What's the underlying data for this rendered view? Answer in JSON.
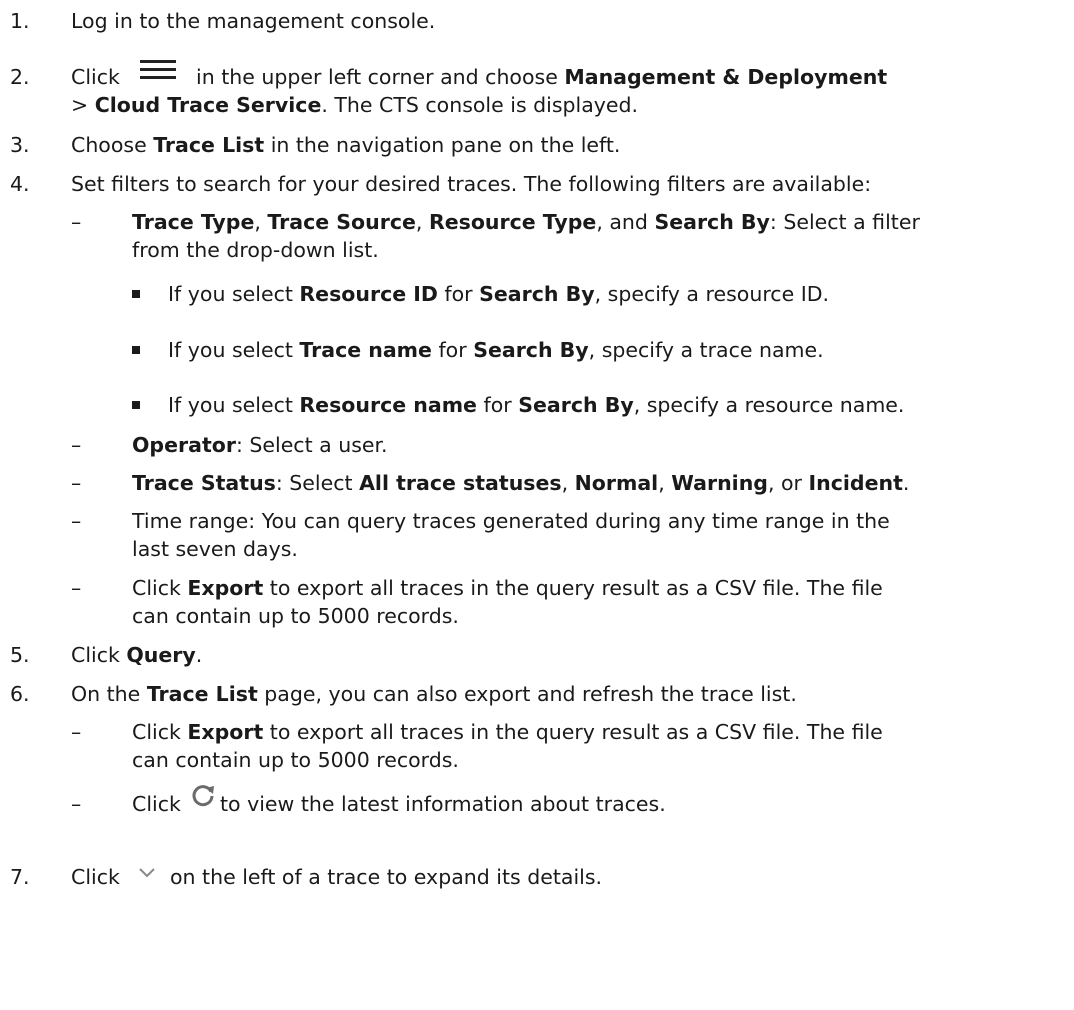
{
  "steps": [
    {
      "number": "1.",
      "text": "Log in to the management console."
    },
    {
      "number": "2.",
      "click": "Click",
      "mid": " in the upper left corner and choose ",
      "b1": "Management & Deployment",
      "gt": "> ",
      "b2": "Cloud Trace Service",
      "end": ". The CTS console is displayed."
    },
    {
      "number": "3.",
      "pre": "Choose ",
      "b1": "Trace List",
      "post": " in the navigation pane on the left."
    },
    {
      "number": "4.",
      "text": "Set filters to search for your desired traces. The following filters are available:"
    },
    {
      "number": "5.",
      "pre": "Click ",
      "b1": "Query",
      "post": "."
    },
    {
      "number": "6.",
      "pre": "On the ",
      "b1": "Trace List",
      "post": " page, you can also export and refresh the trace list."
    },
    {
      "number": "7.",
      "pre": "Click ",
      "post": " on the left of a trace to expand its details."
    }
  ],
  "filters": {
    "type_line": {
      "b1": "Trace Type",
      "s1": ", ",
      "b2": "Trace Source",
      "s2": ", ",
      "b3": "Resource Type",
      "s3": ", and ",
      "b4": "Search By",
      "post": ": Select a filter"
    },
    "type_line2": "from the drop-down list.",
    "search_by": [
      {
        "pre": "If you select ",
        "b1": "Resource ID",
        "mid": " for ",
        "b2": "Search By",
        "post": ", specify a resource ID."
      },
      {
        "pre": "If you select ",
        "b1": "Trace name",
        "mid": " for ",
        "b2": "Search By",
        "post": ", specify a trace name."
      },
      {
        "pre": "If you select ",
        "b1": "Resource name",
        "mid": " for ",
        "b2": "Search By",
        "post": ", specify a resource name."
      }
    ],
    "operator": {
      "b1": "Operator",
      "post": ": Select a user."
    },
    "status": {
      "b1": "Trace Status",
      "s1": ": Select ",
      "b2": "All trace statuses",
      "s2": ", ",
      "b3": "Normal",
      "s3": ", ",
      "b4": "Warning",
      "s4": ", or ",
      "b5": "Incident",
      "post": "."
    },
    "time1": "Time range: You can query traces generated during any time range in the",
    "time2": "last seven days.",
    "export": {
      "pre": "Click ",
      "b1": "Export",
      "post": " to export all traces in the query result as a CSV file. The file",
      "line2": "can contain up to 5000 records."
    }
  },
  "step6_subs": {
    "export": {
      "pre": "Click ",
      "b1": "Export",
      "post": " to export all traces in the query result as a CSV file. The file",
      "line2": "can contain up to 5000 records."
    },
    "refresh": {
      "pre": "Click ",
      "post": " to view the latest information about traces."
    }
  },
  "dash": "–",
  "icons": [
    "menu-icon",
    "refresh-icon",
    "chevron-down-icon"
  ]
}
